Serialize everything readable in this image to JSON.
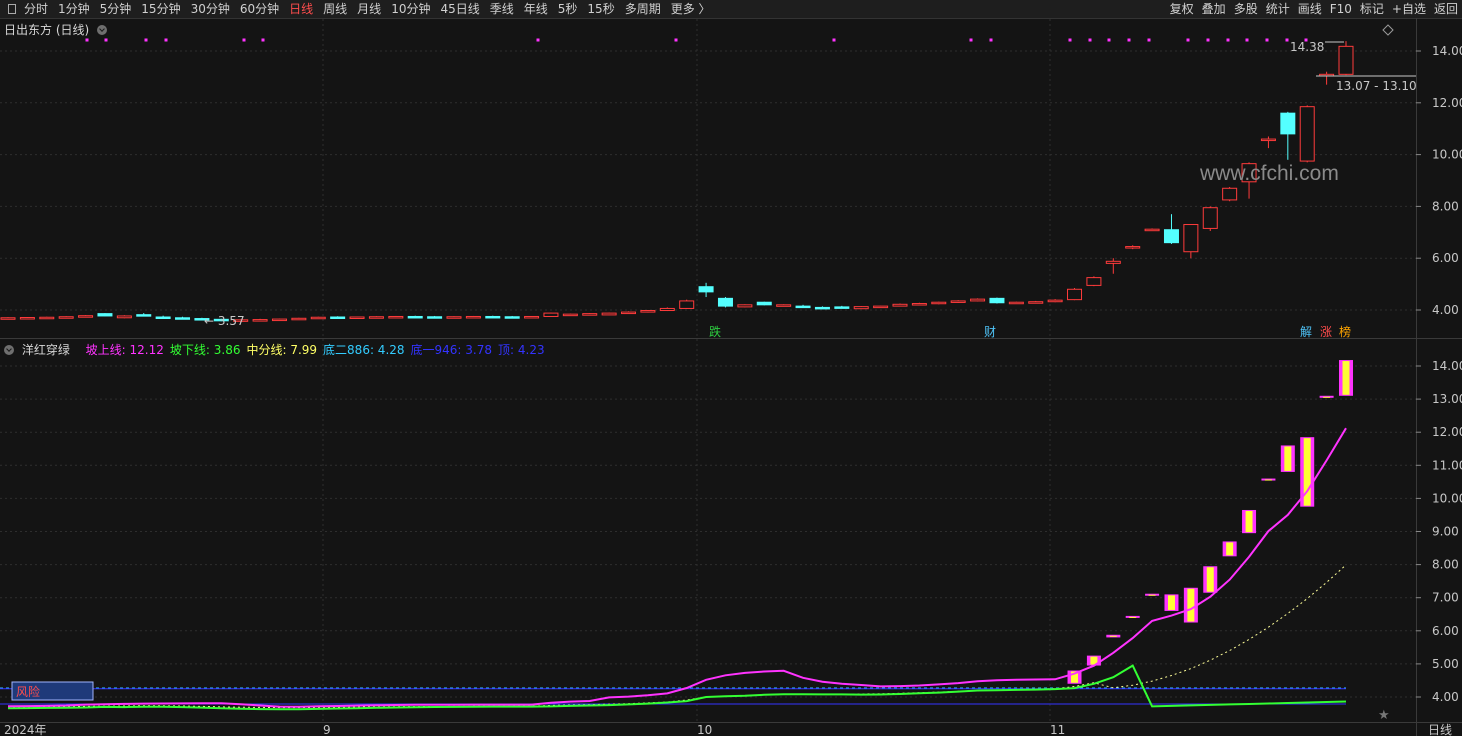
{
  "toolbar": {
    "periods": [
      "分时",
      "1分钟",
      "5分钟",
      "15分钟",
      "30分钟",
      "60分钟",
      "日线",
      "周线",
      "月线",
      "10分钟",
      "45日线",
      "季线",
      "年线",
      "5秒",
      "15秒",
      "多周期",
      "更多 〉"
    ],
    "active_period": "日线",
    "right_buttons": [
      "复权",
      "叠加",
      "多股",
      "统计",
      "画线",
      "F10",
      "标记",
      "+自选",
      "返回"
    ]
  },
  "main_chart": {
    "stock_title": "日出东方 (日线)",
    "y_ticks": [
      "14.00",
      "12.00",
      "10.00",
      "8.00",
      "6.00",
      "4.00"
    ],
    "high_label": "14.38",
    "low_label": "← 3.57",
    "range_label": "13.07 - 13.10",
    "watermark": "www.cfchi.com",
    "event_tags": [
      {
        "text": "跌",
        "color": "#2ecc40"
      },
      {
        "text": "财",
        "color": "#4fc3f7"
      },
      {
        "text": "解",
        "color": "#4fc3f7"
      },
      {
        "text": "涨",
        "color": "#ff4d4d"
      },
      {
        "text": "榜",
        "color": "#ffa500"
      }
    ]
  },
  "indicator": {
    "name": "洋红穿绿",
    "legend": [
      {
        "label": "坡上线: 12.12",
        "color": "#ff33ff"
      },
      {
        "label": "坡下线: 3.86",
        "color": "#33ff33"
      },
      {
        "label": "中分线: 7.99",
        "color": "#ffff66"
      },
      {
        "label": "底二886: 4.28",
        "color": "#33ccff"
      },
      {
        "label": "底一946: 3.78",
        "color": "#3333ff"
      },
      {
        "label": "顶: 4.23",
        "color": "#3333ff"
      }
    ],
    "y_ticks": [
      "14.00",
      "13.00",
      "12.00",
      "11.00",
      "10.00",
      "9.00",
      "8.00",
      "7.00",
      "6.00",
      "5.00",
      "4.00"
    ],
    "risk_label": "风险"
  },
  "x_axis": {
    "labels": [
      "2024年",
      "9",
      "10",
      "11"
    ],
    "period_label": "日线"
  },
  "colors": {
    "up": "#ff3b3b",
    "down": "#54ffff",
    "upper_line": "#ff33ff",
    "lower_line": "#33ff33",
    "mid_line": "#ffff99"
  },
  "chart_data": {
    "type": "candlestick",
    "ylim": [
      3.0,
      15.0
    ],
    "ohlc": [
      [
        3.68,
        3.72,
        3.66,
        3.7
      ],
      [
        3.7,
        3.73,
        3.68,
        3.71
      ],
      [
        3.71,
        3.74,
        3.69,
        3.72
      ],
      [
        3.72,
        3.76,
        3.7,
        3.74
      ],
      [
        3.74,
        3.8,
        3.72,
        3.78
      ],
      [
        3.86,
        3.88,
        3.76,
        3.77
      ],
      [
        3.7,
        3.8,
        3.68,
        3.77
      ],
      [
        3.82,
        3.88,
        3.76,
        3.79
      ],
      [
        3.73,
        3.78,
        3.7,
        3.72
      ],
      [
        3.7,
        3.74,
        3.65,
        3.68
      ],
      [
        3.67,
        3.7,
        3.62,
        3.64
      ],
      [
        3.64,
        3.66,
        3.57,
        3.59
      ],
      [
        3.6,
        3.64,
        3.58,
        3.62
      ],
      [
        3.62,
        3.66,
        3.6,
        3.63
      ],
      [
        3.63,
        3.67,
        3.61,
        3.65
      ],
      [
        3.65,
        3.7,
        3.63,
        3.68
      ],
      [
        3.7,
        3.74,
        3.68,
        3.72
      ],
      [
        3.73,
        3.76,
        3.71,
        3.72
      ],
      [
        3.72,
        3.75,
        3.7,
        3.73
      ],
      [
        3.73,
        3.76,
        3.71,
        3.74
      ],
      [
        3.74,
        3.77,
        3.72,
        3.75
      ],
      [
        3.75,
        3.78,
        3.73,
        3.74
      ],
      [
        3.74,
        3.77,
        3.72,
        3.73
      ],
      [
        3.73,
        3.76,
        3.71,
        3.74
      ],
      [
        3.74,
        3.77,
        3.72,
        3.75
      ],
      [
        3.75,
        3.78,
        3.73,
        3.74
      ],
      [
        3.74,
        3.77,
        3.72,
        3.73
      ],
      [
        3.73,
        3.76,
        3.71,
        3.75
      ],
      [
        3.75,
        3.9,
        3.74,
        3.88
      ],
      [
        3.8,
        3.86,
        3.79,
        3.84
      ],
      [
        3.8,
        3.88,
        3.79,
        3.86
      ],
      [
        3.81,
        3.9,
        3.8,
        3.88
      ],
      [
        3.88,
        3.95,
        3.86,
        3.92
      ],
      [
        3.92,
        4.0,
        3.9,
        3.98
      ],
      [
        3.98,
        4.1,
        3.96,
        4.06
      ],
      [
        4.06,
        4.4,
        4.05,
        4.35
      ],
      [
        4.9,
        5.05,
        4.5,
        4.7
      ],
      [
        4.45,
        4.5,
        4.1,
        4.15
      ],
      [
        4.12,
        4.22,
        4.1,
        4.2
      ],
      [
        4.3,
        4.32,
        4.18,
        4.2
      ],
      [
        4.18,
        4.22,
        4.15,
        4.2
      ],
      [
        4.15,
        4.2,
        4.1,
        4.12
      ],
      [
        4.1,
        4.14,
        4.05,
        4.08
      ],
      [
        4.12,
        4.16,
        4.08,
        4.1
      ],
      [
        4.05,
        4.15,
        4.04,
        4.13
      ],
      [
        4.12,
        4.16,
        4.1,
        4.15
      ],
      [
        4.15,
        4.25,
        4.14,
        4.22
      ],
      [
        4.22,
        4.28,
        4.2,
        4.25
      ],
      [
        4.25,
        4.32,
        4.22,
        4.3
      ],
      [
        4.3,
        4.38,
        4.28,
        4.35
      ],
      [
        4.35,
        4.45,
        4.33,
        4.42
      ],
      [
        4.45,
        4.48,
        4.25,
        4.28
      ],
      [
        4.28,
        4.32,
        4.25,
        4.3
      ],
      [
        4.28,
        4.35,
        4.26,
        4.32
      ],
      [
        4.32,
        4.42,
        4.3,
        4.38
      ],
      [
        4.4,
        4.85,
        4.38,
        4.8
      ],
      [
        4.95,
        5.3,
        4.92,
        5.25
      ],
      [
        5.8,
        6.0,
        5.4,
        5.88
      ],
      [
        6.4,
        6.5,
        6.35,
        6.45
      ],
      [
        7.1,
        7.15,
        7.08,
        7.12
      ],
      [
        7.1,
        7.7,
        6.55,
        6.6
      ],
      [
        6.25,
        7.3,
        6.0,
        7.3
      ],
      [
        7.15,
        8.0,
        7.05,
        7.95
      ],
      [
        8.25,
        8.75,
        8.2,
        8.7
      ],
      [
        8.95,
        9.7,
        8.3,
        9.65
      ],
      [
        10.55,
        10.7,
        10.25,
        10.6
      ],
      [
        11.6,
        11.65,
        9.8,
        10.8
      ],
      [
        9.75,
        11.9,
        9.7,
        11.85
      ],
      [
        13.07,
        13.2,
        12.7,
        13.1
      ],
      [
        13.1,
        14.38,
        13.07,
        14.18
      ]
    ],
    "upper_line_end": 12.12,
    "lower_line_end": 3.86,
    "mid_line_end": 7.99
  }
}
